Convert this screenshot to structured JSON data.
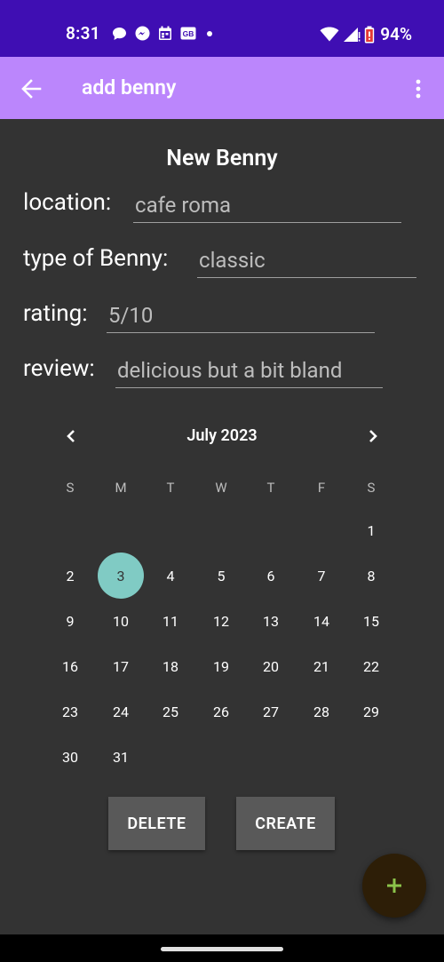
{
  "status_bar": {
    "time": "8:31",
    "battery_percent": "94%",
    "notification_icons": [
      "chat-bubble-icon",
      "messenger-icon",
      "calendar-icon",
      "gb-icon",
      "dot-icon"
    ],
    "background_color": "#3f0eb3"
  },
  "app_bar": {
    "title": "add benny",
    "back_icon": "arrow-back-icon",
    "overflow_icon": "more-vert-icon",
    "background_color": "#bb86fc"
  },
  "form": {
    "title": "New Benny",
    "location": {
      "label": "location:",
      "value": "cafe roma"
    },
    "type": {
      "label": "type of Benny:",
      "value": "classic"
    },
    "rating": {
      "label": "rating:",
      "value": "5/10"
    },
    "review": {
      "label": "review:",
      "value": "delicious but a bit bland"
    }
  },
  "calendar": {
    "month_label": "July 2023",
    "weekdays": [
      "S",
      "M",
      "T",
      "W",
      "T",
      "F",
      "S"
    ],
    "first_weekday_index": 6,
    "days_in_month": 31,
    "selected_day": 3,
    "selected_color": "#80cbc4"
  },
  "buttons": {
    "delete_label": "DELETE",
    "create_label": "CREATE"
  },
  "fab": {
    "icon": "plus-icon",
    "icon_color": "#8bc34a"
  }
}
